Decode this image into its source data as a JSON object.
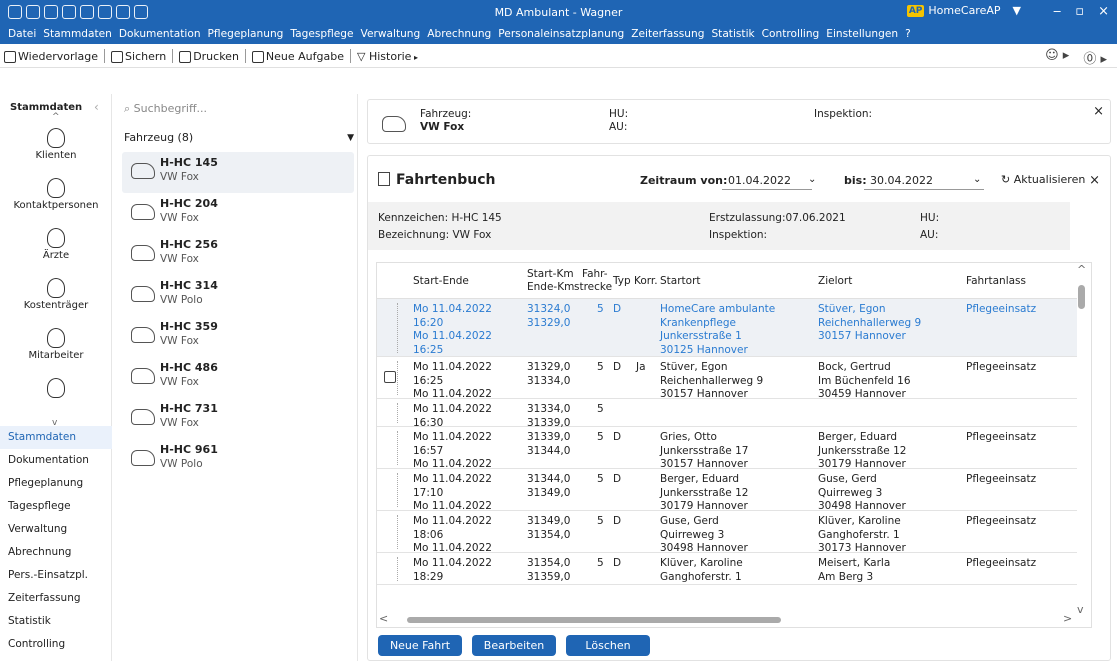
{
  "window": {
    "title": "MD Ambulant - Wagner",
    "brand_badge": "AP",
    "brand_name": "HomeCareAP"
  },
  "menu": [
    "Datei",
    "Stammdaten",
    "Dokumentation",
    "Pflegeplanung",
    "Tagespflege",
    "Verwaltung",
    "Abrechnung",
    "Personaleinsatzplanung",
    "Zeiterfassung",
    "Statistik",
    "Controlling",
    "Einstellungen",
    "?"
  ],
  "toolbar": {
    "wiedervorlage": "Wiedervorlage",
    "sichern": "Sichern",
    "drucken": "Drucken",
    "neue_aufgabe": "Neue Aufgabe",
    "historie": "Historie"
  },
  "sidebar": {
    "header": "Stammdaten",
    "icons": [
      {
        "label": "Klienten",
        "icon": "client-icon"
      },
      {
        "label": "Kontaktpersonen",
        "icon": "contacts-icon"
      },
      {
        "label": "Ärzte",
        "icon": "doctor-icon"
      },
      {
        "label": "Kostenträger",
        "icon": "cost-carrier-icon"
      },
      {
        "label": "Mitarbeiter",
        "icon": "employee-icon"
      },
      {
        "label": "",
        "icon": "more-icon"
      }
    ],
    "nav": [
      "Stammdaten",
      "Dokumentation",
      "Pflegeplanung",
      "Tagespflege",
      "Verwaltung",
      "Abrechnung",
      "Pers.-Einsatzpl.",
      "Zeiterfassung",
      "Statistik",
      "Controlling"
    ]
  },
  "vehiclelist": {
    "search_placeholder": "Suchbegriff...",
    "filter_label": "Fahrzeug (8)",
    "items": [
      {
        "plate": "H-HC 145",
        "model": "VW Fox"
      },
      {
        "plate": "H-HC 204",
        "model": "VW Fox"
      },
      {
        "plate": "H-HC 256",
        "model": "VW Fox"
      },
      {
        "plate": "H-HC 314",
        "model": "VW Polo"
      },
      {
        "plate": "H-HC 359",
        "model": "VW Fox"
      },
      {
        "plate": "H-HC 486",
        "model": "VW Fox"
      },
      {
        "plate": "H-HC 731",
        "model": "VW Fox"
      },
      {
        "plate": "H-HC 961",
        "model": "VW Polo"
      }
    ]
  },
  "topcard": {
    "fahrzeug_label": "Fahrzeug:",
    "fahrzeug_value": "VW Fox",
    "hu": "HU:",
    "au": "AU:",
    "inspektion": "Inspektion:"
  },
  "fahrtenbuch": {
    "title": "Fahrtenbuch",
    "zeitraum_label": "Zeitraum von:",
    "von": "01.04.2022",
    "bis_label": "bis:",
    "bis": "30.04.2022",
    "refresh": "Aktualisieren",
    "info": {
      "kennzeichen": "Kennzeichen: H-HC 145",
      "bezeichnung": "Bezeichnung: VW Fox",
      "erstzulassung": "Erstzulassung:07.06.2021",
      "inspektion": "Inspektion:",
      "hu": "HU:",
      "au": "AU:"
    },
    "columns": {
      "startende": "Start-Ende",
      "startkm": "Start-Km",
      "endekm": "Ende-Km",
      "fahr": "Fahr-",
      "strecke": "strecke",
      "typ": "Typ",
      "korr": "Korr.",
      "startort": "Startort",
      "zielort": "Zielort",
      "fahrtanlass": "Fahrtanlass"
    },
    "rows": [
      {
        "t1": "Mo 11.04.2022",
        "t2": "16:20",
        "t3": "Mo 11.04.2022",
        "t4": "16:25",
        "km1": "31324,0",
        "km2": "31329,0",
        "strecke": "5",
        "typ": "D",
        "korr": "",
        "s1": "HomeCare ambulante",
        "s2": "Krankenpflege",
        "s3": "Junkersstraße 1",
        "s4": "30125 Hannover",
        "z1": "Stüver, Egon",
        "z2": "Reichenhallerweg 9",
        "z3": "30157 Hannover",
        "anlass": "Pflegeeinsatz"
      },
      {
        "t1": "Mo 11.04.2022",
        "t2": "16:25",
        "t3": "Mo 11.04.2022",
        "t4": "",
        "km1": "31329,0",
        "km2": "31334,0",
        "strecke": "5",
        "typ": "D",
        "korr": "Ja",
        "s1": "Stüver, Egon",
        "s2": "Reichenhallerweg 9",
        "s3": "30157 Hannover",
        "s4": "",
        "z1": "Bock, Gertrud",
        "z2": "Im Büchenfeld 16",
        "z3": "30459 Hannover",
        "anlass": "Pflegeeinsatz"
      },
      {
        "t1": "Mo 11.04.2022",
        "t2": "16:30",
        "t3": "",
        "t4": "",
        "km1": "31334,0",
        "km2": "31339,0",
        "strecke": "5",
        "typ": "",
        "korr": "",
        "s1": "",
        "s2": "",
        "s3": "",
        "s4": "",
        "z1": "",
        "z2": "",
        "z3": "",
        "anlass": ""
      },
      {
        "t1": "Mo 11.04.2022",
        "t2": "16:57",
        "t3": "Mo 11.04.2022",
        "t4": "",
        "km1": "31339,0",
        "km2": "31344,0",
        "strecke": "5",
        "typ": "D",
        "korr": "",
        "s1": "Gries, Otto",
        "s2": "Junkersstraße 17",
        "s3": "30157 Hannover",
        "s4": "",
        "z1": "Berger, Eduard",
        "z2": "Junkersstraße 12",
        "z3": "30179 Hannover",
        "anlass": "Pflegeeinsatz"
      },
      {
        "t1": "Mo 11.04.2022",
        "t2": "17:10",
        "t3": "Mo 11.04.2022",
        "t4": "",
        "km1": "31344,0",
        "km2": "31349,0",
        "strecke": "5",
        "typ": "D",
        "korr": "",
        "s1": "Berger, Eduard",
        "s2": "Junkersstraße 12",
        "s3": "30179 Hannover",
        "s4": "",
        "z1": "Guse, Gerd",
        "z2": "Quirreweg 3",
        "z3": "30498 Hannover",
        "anlass": "Pflegeeinsatz"
      },
      {
        "t1": "Mo 11.04.2022",
        "t2": "18:06",
        "t3": "Mo 11.04.2022",
        "t4": "",
        "km1": "31349,0",
        "km2": "31354,0",
        "strecke": "5",
        "typ": "D",
        "korr": "",
        "s1": "Guse, Gerd",
        "s2": "Quirreweg 3",
        "s3": "30498 Hannover",
        "s4": "",
        "z1": "Klüver, Karoline",
        "z2": "Ganghoferstr. 1",
        "z3": "30173 Hannover",
        "anlass": "Pflegeeinsatz"
      },
      {
        "t1": "Mo 11.04.2022",
        "t2": "18:29",
        "t3": "",
        "t4": "",
        "km1": "31354,0",
        "km2": "31359,0",
        "strecke": "5",
        "typ": "D",
        "korr": "",
        "s1": "Klüver, Karoline",
        "s2": "Ganghoferstr. 1",
        "s3": "",
        "s4": "",
        "z1": "Meisert, Karla",
        "z2": "Am Berg 3",
        "z3": "",
        "anlass": "Pflegeeinsatz"
      }
    ],
    "buttons": {
      "neu": "Neue Fahrt",
      "bearbeiten": "Bearbeiten",
      "loeschen": "Löschen"
    }
  }
}
